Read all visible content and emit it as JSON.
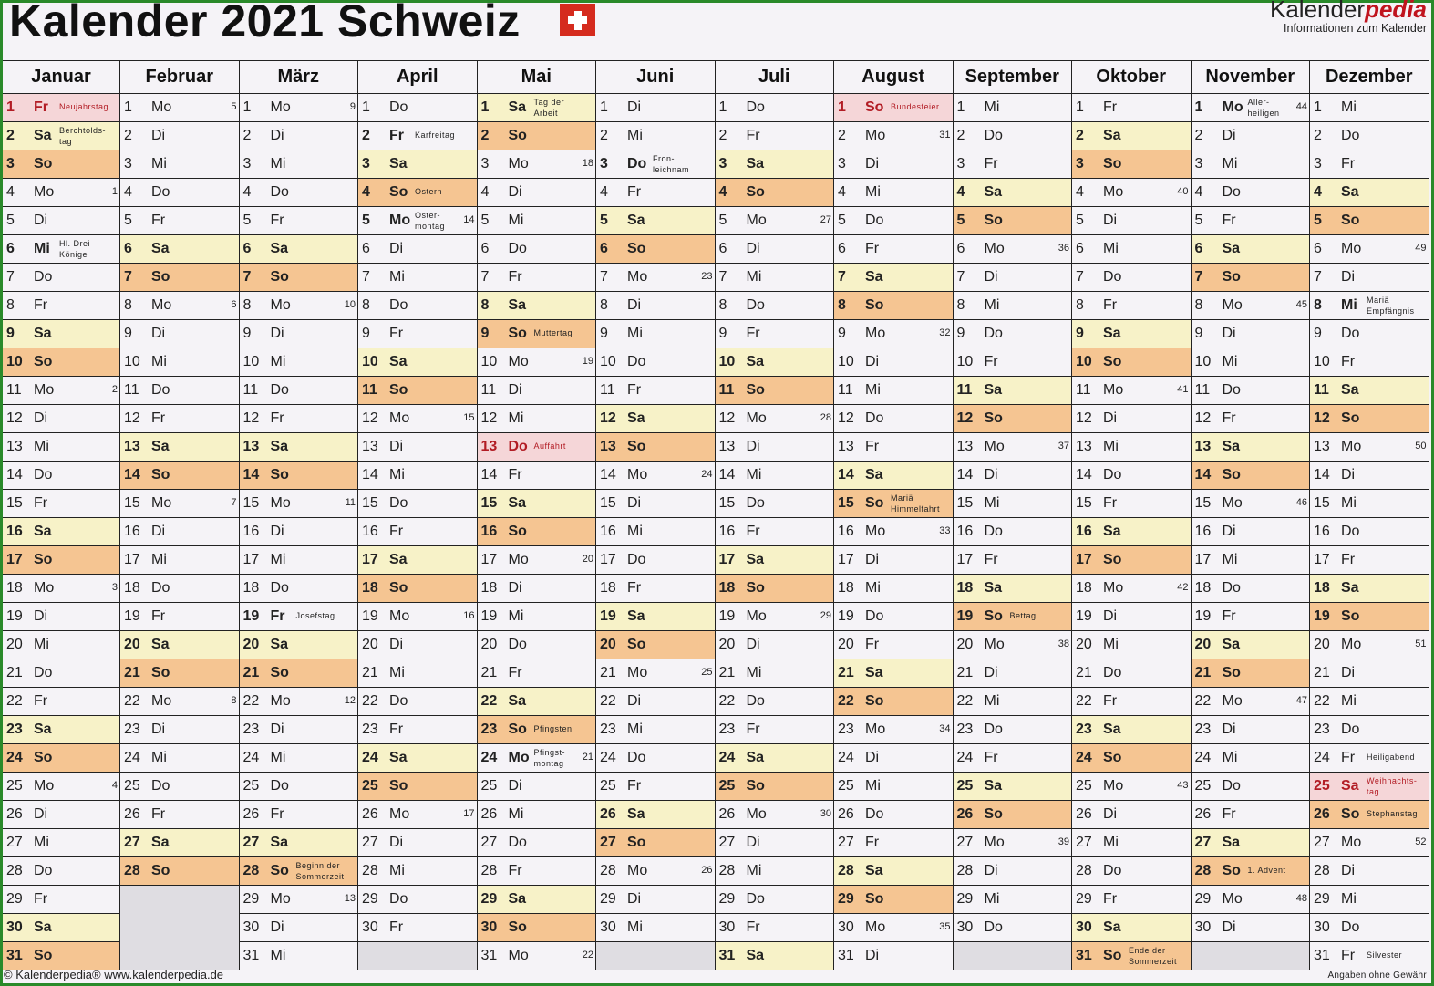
{
  "header": {
    "title": "Kalender 2021 Schweiz",
    "flag_icon": "swiss-flag-icon",
    "brand_prefix": "Kalender",
    "brand_suffix": "pedia",
    "brand_tagline": "Informationen zum Kalender"
  },
  "colors": {
    "saturday": "#f7f2c8",
    "sunday": "#f5c592",
    "holiday": "#f5d6d8",
    "holiday_text": "#b21c24",
    "frame": "#2a8a2a",
    "flag": "#d52b1e"
  },
  "weekday_abbr": [
    "Mo",
    "Di",
    "Mi",
    "Do",
    "Fr",
    "Sa",
    "So"
  ],
  "months": [
    {
      "name": "Januar",
      "days": 31,
      "start": 4,
      "holidays": {
        "1": "Neujahrstag",
        "2": "Berchtolds-\ntag",
        "6": "Hl. Drei\nKönige"
      },
      "red": [
        1
      ],
      "bold": [
        2,
        6
      ],
      "weeks": {
        "4": "1",
        "11": "2",
        "18": "3",
        "25": "4"
      }
    },
    {
      "name": "Februar",
      "days": 28,
      "start": 0,
      "holidays": {},
      "red": [],
      "bold": [],
      "weeks": {
        "1": "5",
        "8": "6",
        "15": "7",
        "22": "8"
      }
    },
    {
      "name": "März",
      "days": 31,
      "start": 0,
      "holidays": {
        "19": "Josefstag",
        "28": "Beginn der\nSommerzeit"
      },
      "red": [],
      "bold": [
        19
      ],
      "weeks": {
        "1": "9",
        "8": "10",
        "15": "11",
        "22": "12",
        "29": "13"
      }
    },
    {
      "name": "April",
      "days": 30,
      "start": 3,
      "holidays": {
        "2": "Karfreitag",
        "4": "Ostern",
        "5": "Oster-\nmontag"
      },
      "red": [],
      "bold": [
        2,
        5
      ],
      "weeks": {
        "5": "14",
        "12": "15",
        "19": "16",
        "26": "17"
      }
    },
    {
      "name": "Mai",
      "days": 31,
      "start": 5,
      "holidays": {
        "1": "Tag der\nArbeit",
        "9": "Muttertag",
        "13": "Auffahrt",
        "23": "Pfingsten",
        "24": "Pfingst-\nmontag"
      },
      "red": [
        13
      ],
      "bold": [
        24
      ],
      "weeks": {
        "3": "18",
        "10": "19",
        "17": "20",
        "24": "21",
        "31": "22"
      }
    },
    {
      "name": "Juni",
      "days": 30,
      "start": 1,
      "holidays": {
        "3": "Fron-\nleichnam"
      },
      "red": [],
      "bold": [
        3
      ],
      "weeks": {
        "7": "23",
        "14": "24",
        "21": "25",
        "28": "26"
      }
    },
    {
      "name": "Juli",
      "days": 31,
      "start": 3,
      "holidays": {},
      "red": [],
      "bold": [],
      "weeks": {
        "5": "27",
        "12": "28",
        "19": "29",
        "26": "30"
      }
    },
    {
      "name": "August",
      "days": 31,
      "start": 6,
      "holidays": {
        "1": "Bundesfeier",
        "15": "Mariä\nHimmelfahrt"
      },
      "red": [
        1
      ],
      "bold": [],
      "weeks": {
        "2": "31",
        "9": "32",
        "16": "33",
        "23": "34",
        "30": "35"
      }
    },
    {
      "name": "September",
      "days": 30,
      "start": 2,
      "holidays": {
        "19": "Bettag"
      },
      "red": [],
      "bold": [],
      "weeks": {
        "6": "36",
        "13": "37",
        "20": "38",
        "27": "39"
      }
    },
    {
      "name": "Oktober",
      "days": 31,
      "start": 4,
      "holidays": {
        "31": "Ende der\nSommerzeit"
      },
      "red": [],
      "bold": [],
      "weeks": {
        "4": "40",
        "11": "41",
        "18": "42",
        "25": "43"
      }
    },
    {
      "name": "November",
      "days": 30,
      "start": 0,
      "holidays": {
        "1": "Aller-\nheiligen",
        "28": "1. Advent"
      },
      "red": [],
      "bold": [
        1
      ],
      "weeks": {
        "1": "44",
        "8": "45",
        "15": "46",
        "22": "47",
        "29": "48"
      }
    },
    {
      "name": "Dezember",
      "days": 31,
      "start": 2,
      "holidays": {
        "8": "Mariä\nEmpfängnis",
        "24": "Heiligabend",
        "25": "Weihnachts-\ntag",
        "26": "Stephanstag",
        "31": "Silvester"
      },
      "red": [
        25
      ],
      "bold": [
        8
      ],
      "weeks": {
        "6": "49",
        "13": "50",
        "20": "51",
        "27": "52"
      }
    }
  ],
  "footer": {
    "copyright": "© Kalenderpedia®   www.kalenderpedia.de",
    "disclaimer": "Angaben ohne Gewähr"
  }
}
